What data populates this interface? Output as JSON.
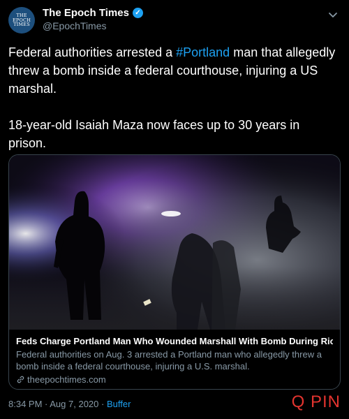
{
  "account": {
    "display_name": "The Epoch Times",
    "handle": "@EpochTimes",
    "avatar_lines": [
      "THE",
      "EPOCH",
      "TIMES"
    ]
  },
  "tweet": {
    "line1_pre": "Federal authorities arrested a ",
    "hashtag": "#Portland",
    "line1_post": " man that allegedly threw a bomb inside a federal courthouse, injuring a US marshal.",
    "paragraph2": "18-year-old Isaiah Maza now faces up to 30 years in prison."
  },
  "card": {
    "title": "Feds Charge Portland Man Who Wounded Marshall With Bomb During Riot",
    "description": "Federal authorities on Aug. 3 arrested a Portland man who allegedly threw a bomb inside a federal courthouse, injuring a U.S. marshal.",
    "domain": "theepochtimes.com"
  },
  "meta": {
    "time": "8:34 PM",
    "separator1": " · ",
    "date": "Aug 7, 2020",
    "separator2": " · ",
    "source": "Buffer"
  },
  "watermark": "Q PIN",
  "colors": {
    "accent": "#1da1f2",
    "background": "#000000",
    "secondary_text": "#8899a6",
    "watermark": "#e3342f"
  },
  "icons": [
    "verified-badge-icon",
    "chevron-down-icon",
    "link-icon"
  ]
}
